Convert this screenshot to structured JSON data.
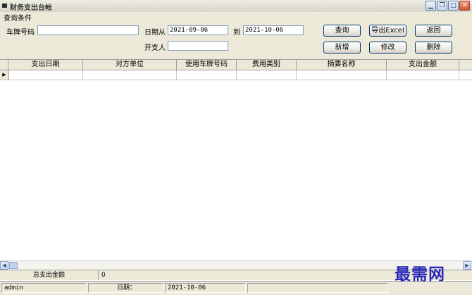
{
  "window": {
    "title": "财务支出台帐",
    "buttons": {
      "minimize": "▁",
      "restore": "❐",
      "maximize": "□",
      "close": "✕"
    }
  },
  "filter": {
    "group_label": "查询条件",
    "plate_label": "车牌号码",
    "plate_value": "",
    "date_from_label": "日期从",
    "date_from_value": "2021-09-06",
    "date_to_label": "到",
    "date_to_value": "2021-10-06",
    "issuer_label": "开支人",
    "issuer_value": ""
  },
  "actions": {
    "query": "查询",
    "export": "导出Excel",
    "back": "返回",
    "add": "新增",
    "edit": "修改",
    "delete": "删除"
  },
  "table": {
    "columns": [
      "支出日期",
      "对方单位",
      "使用车牌号码",
      "费用类别",
      "摘要名称",
      "支出金额"
    ],
    "current_row_marker": "▶"
  },
  "totals": {
    "label": "总支出金额",
    "value": "0"
  },
  "status_bar": {
    "user": "admin",
    "date_label": "日期：",
    "date_value": "2021-10-06"
  },
  "watermark": "最需网"
}
